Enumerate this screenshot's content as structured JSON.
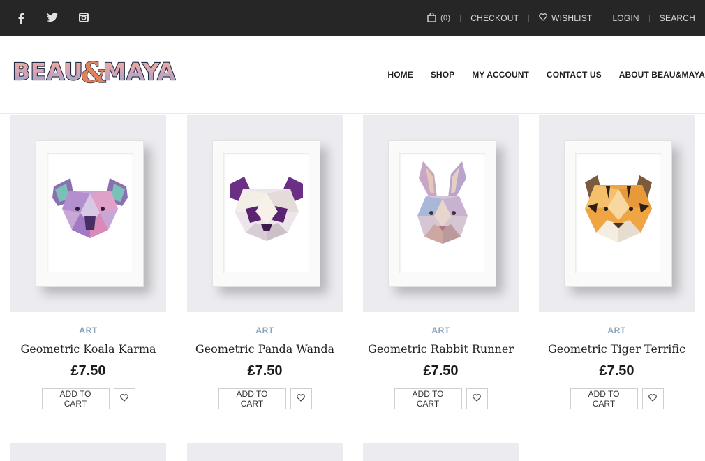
{
  "topbar": {
    "social_icons": [
      "facebook-icon",
      "twitter-icon",
      "instagram-icon"
    ],
    "cart_count": "(0)",
    "checkout": "CHECKOUT",
    "wishlist": "WISHLIST",
    "login": "LOGIN",
    "search": "SEARCH"
  },
  "brand": {
    "logo_text": "BEAU&MAYA"
  },
  "nav": {
    "items": [
      "HOME",
      "SHOP",
      "MY ACCOUNT",
      "CONTACT US",
      "ABOUT BEAU&MAYA"
    ]
  },
  "products": [
    {
      "category": "ART",
      "name": "Geometric Koala Karma",
      "price": "£7.50",
      "add_to_cart": "ADD TO CART"
    },
    {
      "category": "ART",
      "name": "Geometric Panda Wanda",
      "price": "£7.50",
      "add_to_cart": "ADD TO CART"
    },
    {
      "category": "ART",
      "name": "Geometric Rabbit Runner",
      "price": "£7.50",
      "add_to_cart": "ADD TO CART"
    },
    {
      "category": "ART",
      "name": "Geometric Tiger Terrific",
      "price": "£7.50",
      "add_to_cart": "ADD TO CART"
    }
  ],
  "colors": {
    "topbar_bg": "#262626",
    "category": "#8aa3b8",
    "thumb_bg": "#ecebef"
  }
}
